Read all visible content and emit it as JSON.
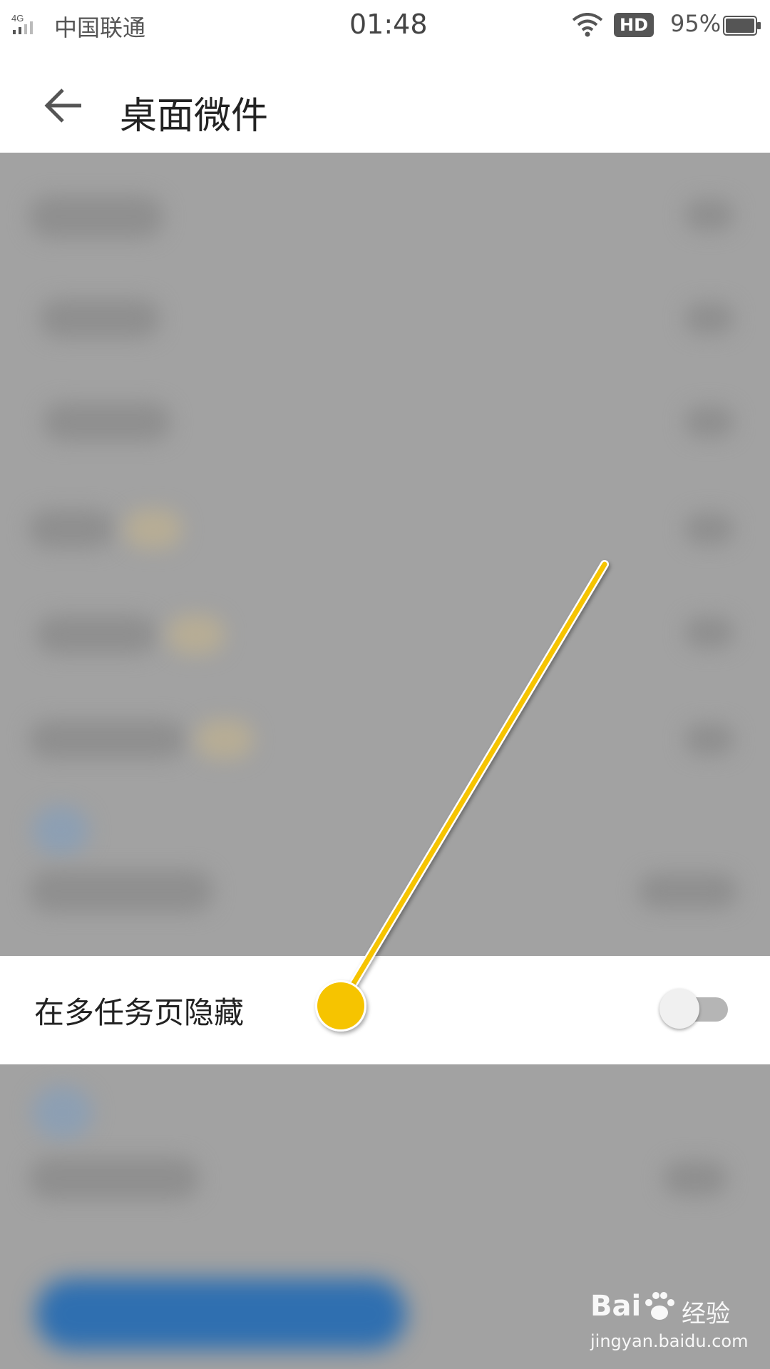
{
  "status_bar": {
    "network": "4G",
    "carrier": "中国联通",
    "time": "01:48",
    "hd_badge": "HD",
    "battery_percent": "95%",
    "icons": [
      "signal-icon",
      "wifi-icon",
      "battery-icon"
    ]
  },
  "header": {
    "back_icon": "back-arrow-icon",
    "title": "桌面微件"
  },
  "highlighted_setting": {
    "label": "在多任务页隐藏",
    "toggle_on": false
  },
  "annotation": {
    "color": "#f6c400",
    "icon": "callout-pointer"
  },
  "watermark": {
    "brand": "Bai",
    "brand_cn": "经验",
    "url": "jingyan.baidu.com"
  },
  "colors": {
    "dim_overlay": "#a2a2a2",
    "toggle_track": "#b5b5b5",
    "toggle_thumb": "#f0f0f0"
  }
}
